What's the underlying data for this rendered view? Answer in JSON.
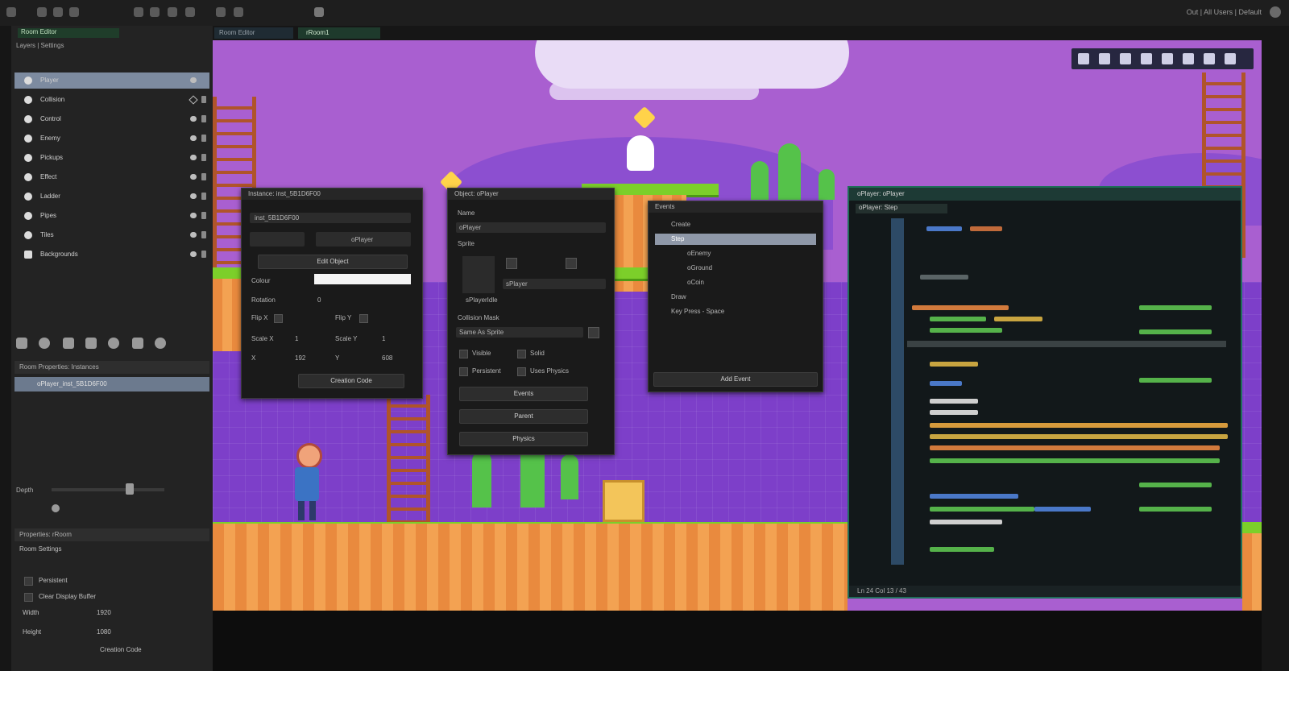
{
  "top_bar": {
    "tabs": [
      "Room Editor",
      "rRoom1"
    ],
    "right_status": "Out | All Users | Default"
  },
  "left_panel": {
    "title": "Room Editor",
    "layers_header": "Layers | Settings",
    "layers": [
      {
        "name": "Player",
        "selected": true
      },
      {
        "name": "Collision",
        "selected": false
      },
      {
        "name": "Control",
        "selected": false
      },
      {
        "name": "Enemy",
        "selected": false
      },
      {
        "name": "Pickups",
        "selected": false
      },
      {
        "name": "Effect",
        "selected": false
      },
      {
        "name": "Ladder",
        "selected": false
      },
      {
        "name": "Pipes",
        "selected": false
      },
      {
        "name": "Tiles",
        "selected": false
      },
      {
        "name": "Backgrounds",
        "selected": false
      }
    ],
    "instances_header": "Room Properties: Instances",
    "instance_selected": "oPlayer_inst_5B1D6F00",
    "depth_label": "Depth",
    "properties_header": "Properties: rRoom",
    "room_settings": "Room Settings",
    "persistent": "Persistent",
    "clear_display": "Clear Display Buffer",
    "width_label": "Width",
    "width_value": "1920",
    "height_label": "Height",
    "height_value": "1080",
    "creation_code": "Creation Code"
  },
  "instance_window": {
    "title": "Instance: inst_5B1D6F00",
    "name": "inst_5B1D6F00",
    "object": "oPlayer",
    "edit_object": "Edit Object",
    "colour": "Colour",
    "rotation": "Rotation",
    "rotation_value": "0",
    "flip_x": "Flip X",
    "flip_y": "Flip Y",
    "scale_x": "Scale X",
    "scale_x_value": "1",
    "scale_y": "Scale Y",
    "scale_y_value": "1",
    "x_label": "X",
    "x_value": "192",
    "y_label": "Y",
    "y_value": "608",
    "creation_code": "Creation Code"
  },
  "object_window": {
    "title": "Object: oPlayer",
    "name_label": "Name",
    "name_value": "oPlayer",
    "sprite_label": "Sprite",
    "sprite_value": "sPlayer",
    "sprite_caption": "sPlayerIdle",
    "collision_mask": "Collision Mask",
    "mask_value": "Same As Sprite",
    "visible": "Visible",
    "solid": "Solid",
    "persistent": "Persistent",
    "uses_physics": "Uses Physics",
    "events_btn": "Events",
    "parent_btn": "Parent",
    "physics_btn": "Physics"
  },
  "events_window": {
    "title": "Events",
    "items": [
      "Create",
      "Step",
      "oEnemy",
      "oGround",
      "oCoin",
      "Draw",
      "Key Press - Space"
    ],
    "selected_index": 1,
    "add_event": "Add Event"
  },
  "code_editor": {
    "title": "oPlayer: oPlayer",
    "tab": "oPlayer: Step",
    "status": "Ln 24 Col 13 / 43"
  },
  "colors": {
    "room_bg": "#a95fd0",
    "grid_bg": "#7d3fc9",
    "grass": "#7ccf2a",
    "dirt": "#e98a3e",
    "editor_bg": "#161616",
    "selection": "#7d8ba0",
    "code_border": "#1f6e5a"
  }
}
